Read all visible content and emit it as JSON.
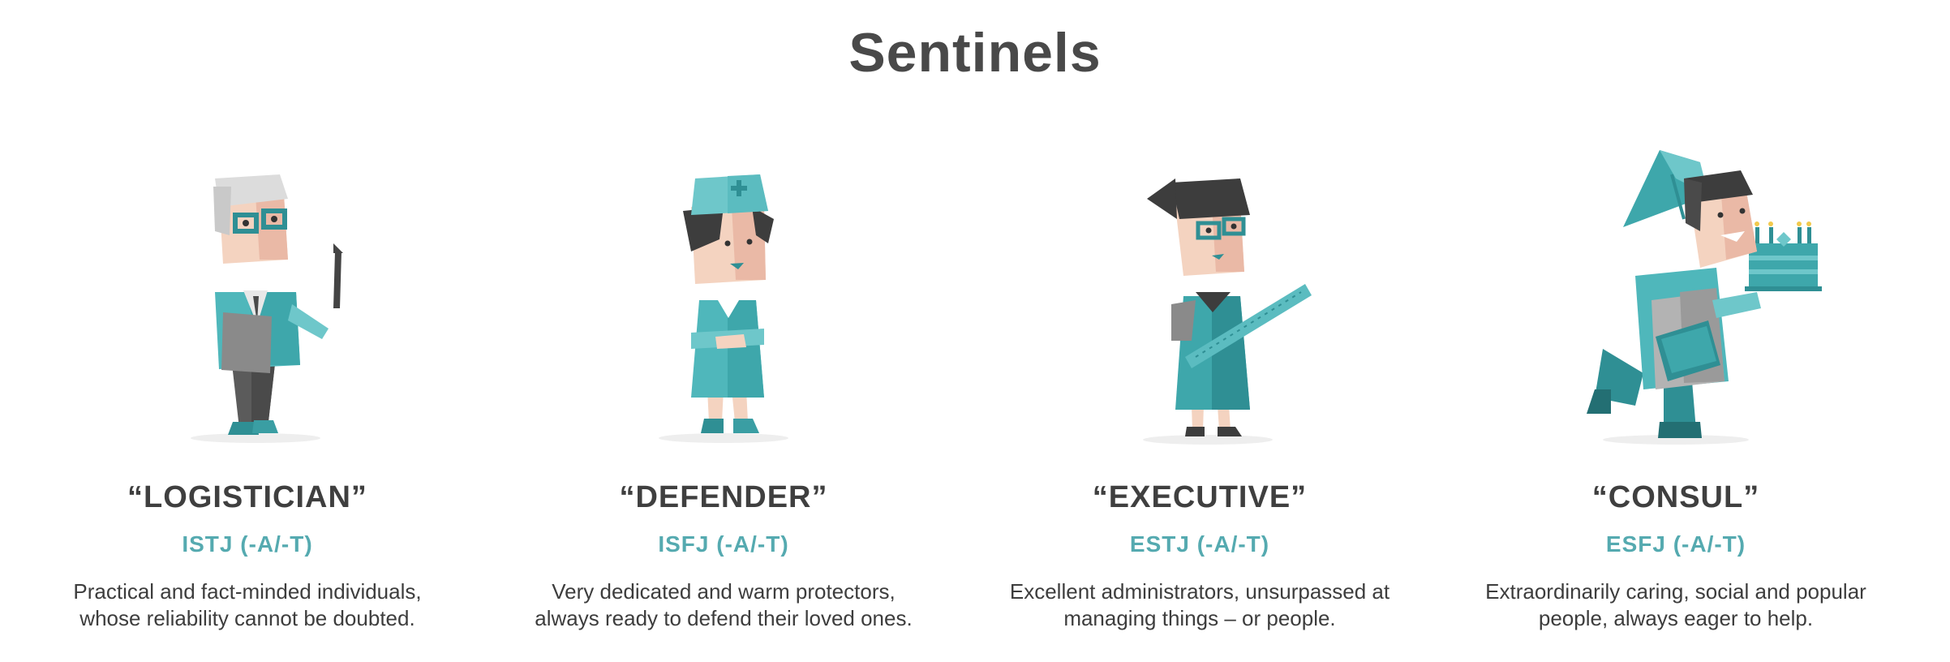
{
  "page": {
    "title": "Sentinels"
  },
  "cards": [
    {
      "name": "“LOGISTICIAN”",
      "code": "ISTJ (-A/-T)",
      "desc1": "Practical and fact-minded individuals,",
      "desc2": "whose reliability cannot be doubted."
    },
    {
      "name": "“DEFENDER”",
      "code": "ISFJ (-A/-T)",
      "desc1": "Very dedicated and warm protectors,",
      "desc2": "always ready to defend their loved ones."
    },
    {
      "name": "“EXECUTIVE”",
      "code": "ESTJ (-A/-T)",
      "desc1": "Excellent administrators, unsurpassed at",
      "desc2": "managing things – or people."
    },
    {
      "name": "“CONSUL”",
      "code": "ESFJ (-A/-T)",
      "desc1": "Extraordinarily caring, social and popular",
      "desc2": "people, always eager to help."
    }
  ],
  "colors": {
    "accent": "#55aab0",
    "teal": "#4fb7bb",
    "dark_teal": "#2f8f94",
    "skin": "#f4d3c0",
    "hair_dark": "#3d3d3d",
    "grey": "#9a9a9a"
  }
}
